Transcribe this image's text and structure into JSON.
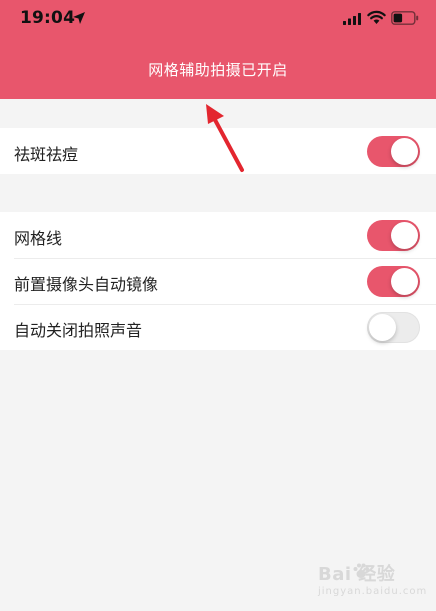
{
  "status_bar": {
    "time": "19:04",
    "icons": [
      "location-arrow-icon",
      "signal-bars-icon",
      "wifi-icon",
      "battery-icon"
    ]
  },
  "header": {
    "message": "网格辅助拍摄已开启",
    "background_color": "#e8566c"
  },
  "sections": [
    {
      "rows": [
        {
          "label": "祛斑祛痘",
          "toggle_on": true
        }
      ]
    },
    {
      "rows": [
        {
          "label": "网格线",
          "toggle_on": true
        },
        {
          "label": "前置摄像头自动镜像",
          "toggle_on": true
        },
        {
          "label": "自动关闭拍照声音",
          "toggle_on": false
        }
      ]
    }
  ],
  "annotation": {
    "icon": "red-arrow-icon",
    "color": "#e3262f"
  },
  "watermark": {
    "text": "Bai  经验",
    "sub": "jingyan.baidu.com"
  }
}
